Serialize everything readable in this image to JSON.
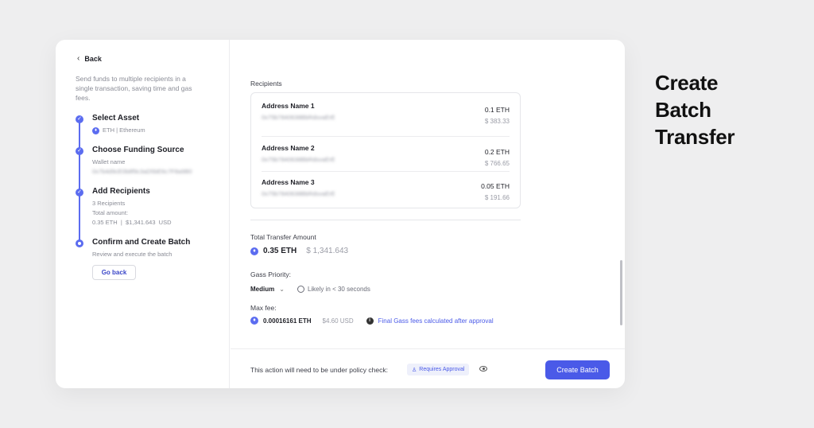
{
  "headline": [
    "Create",
    "Batch",
    "Transfer"
  ],
  "sidebar": {
    "back_label": "Back",
    "description": "Send funds to multiple recipients in a single transaction, saving time and gas fees.",
    "steps": [
      {
        "title": "Select Asset",
        "sub": "ETH | Ethereum"
      },
      {
        "title": "Choose Funding Source",
        "sub": "Wallet name",
        "sub2": "0x7b4d9cE0b8f9c3aD5bE6c7F8a9B0"
      },
      {
        "title": "Add Recipients",
        "sub": "3 Recipients",
        "sub2": "Total amount:",
        "sub3": "0.35 ETH  |  $1,341.643  USD"
      },
      {
        "title": "Confirm and Create Batch",
        "sub": "Review and execute the batch"
      }
    ],
    "go_back_label": "Go back"
  },
  "main": {
    "recipients_label": "Recipients",
    "recipients": [
      {
        "name": "Address Name 1",
        "address": "0x75b7840638BbRdsvaErE",
        "eth": "0.1 ETH",
        "usd": "$ 383.33"
      },
      {
        "name": "Address Name 2",
        "address": "0x75b7840638BbRdsvaErE",
        "eth": "0.2 ETH",
        "usd": "$ 766.65"
      },
      {
        "name": "Address Name 3",
        "address": "0x75b7840638BbRdsvaErE",
        "eth": "0.05 ETH",
        "usd": "$ 191.66"
      }
    ],
    "total_label": "Total Transfer Amount",
    "total_eth": "0.35 ETH",
    "total_usd": "$ 1,341.643",
    "priority_label": "Gass Priority:",
    "priority_value": "Medium",
    "priority_estimate": "Likely in < 30 seconds",
    "max_fee_label": "Max fee:",
    "max_fee_eth": "0.00016161 ETH",
    "max_fee_usd": "$4.60 USD",
    "max_fee_note": "Final Gass fees calculated after approval"
  },
  "footer": {
    "policy_text": "This action will need to be under policy check:",
    "badge_label": "Requires Approval",
    "create_label": "Create Batch"
  },
  "colors": {
    "accent": "#4a5ae8",
    "step": "#5b6cf0"
  }
}
